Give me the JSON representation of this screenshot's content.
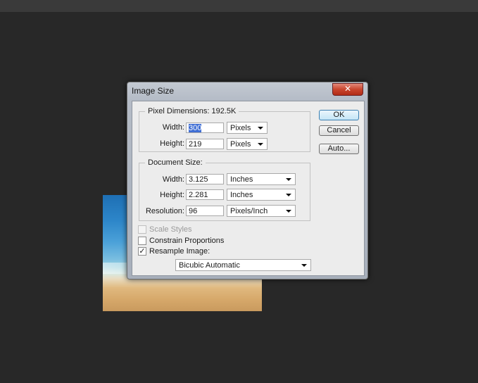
{
  "dialog": {
    "title": "Image Size",
    "close_label": "✕"
  },
  "pixel_dimensions": {
    "title": "Pixel Dimensions:  192.5K",
    "width_label": "Width:",
    "width_value": "300",
    "width_unit": "Pixels",
    "height_label": "Height:",
    "height_value": "219",
    "height_unit": "Pixels"
  },
  "document_size": {
    "title": "Document Size:",
    "width_label": "Width:",
    "width_value": "3.125",
    "width_unit": "Inches",
    "height_label": "Height:",
    "height_value": "2.281",
    "height_unit": "Inches",
    "resolution_label": "Resolution:",
    "resolution_value": "96",
    "resolution_unit": "Pixels/Inch"
  },
  "options": {
    "scale_styles": {
      "label": "Scale Styles",
      "checked": false,
      "disabled": true
    },
    "constrain_proportions": {
      "label": "Constrain Proportions",
      "checked": false
    },
    "resample_image": {
      "label": "Resample Image:",
      "checked": true,
      "mark": "✓"
    },
    "resample_method": "Bicubic Automatic"
  },
  "buttons": {
    "ok": "OK",
    "cancel": "Cancel",
    "auto": "Auto..."
  }
}
